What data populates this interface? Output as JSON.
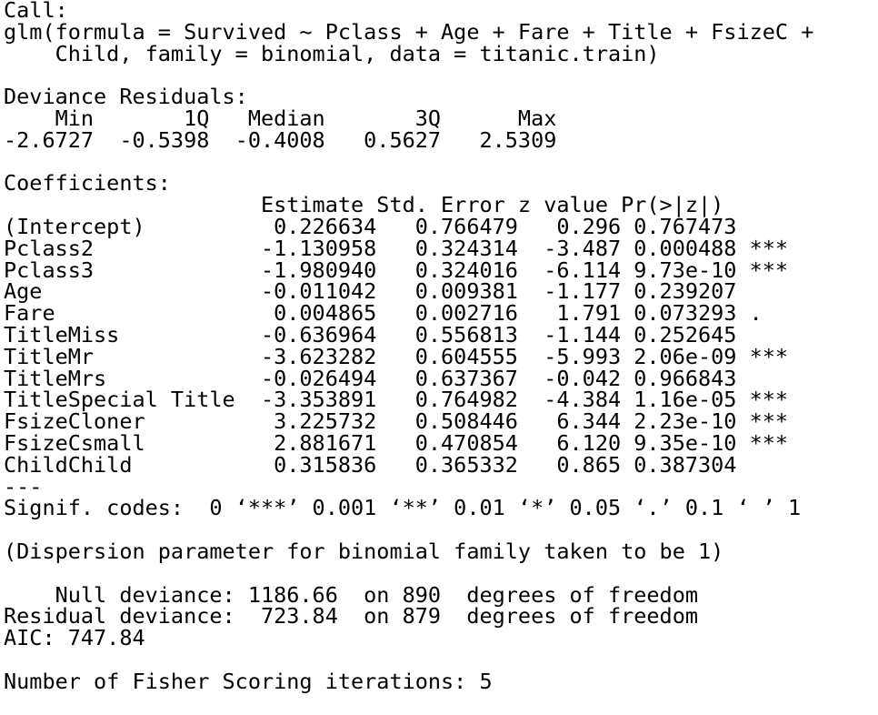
{
  "call": {
    "header": "Call:",
    "lines": [
      "glm(formula = Survived ~ Pclass + Age + Fare + Title + FsizeC +",
      "    Child, family = binomial, data = titanic.train)"
    ]
  },
  "deviance_residuals": {
    "header": "Deviance Residuals:",
    "labels_line": "    Min       1Q   Median       3Q      Max  ",
    "values_line": "-2.6727  -0.5398  -0.4008   0.5627   2.5309  ",
    "labels": [
      "Min",
      "1Q",
      "Median",
      "3Q",
      "Max"
    ],
    "values": [
      "-2.6727",
      "-0.5398",
      "-0.4008",
      "0.5627",
      "2.5309"
    ]
  },
  "coefficients": {
    "header": "Coefficients:",
    "columns": [
      "Estimate",
      "Std. Error",
      "z value",
      "Pr(>|z|)"
    ],
    "header_line": "                    Estimate Std. Error z value Pr(>|z|)    ",
    "rows": [
      {
        "name": "(Intercept)",
        "estimate": "0.226634",
        "std_error": "0.766479",
        "z_value": "0.296",
        "p_value": "0.767473",
        "signif": "",
        "line": "(Intercept)          0.226634   0.766479   0.296 0.767473    "
      },
      {
        "name": "Pclass2",
        "estimate": "-1.130958",
        "std_error": "0.324314",
        "z_value": "-3.487",
        "p_value": "0.000488",
        "signif": "***",
        "line": "Pclass2             -1.130958   0.324314  -3.487 0.000488 ***"
      },
      {
        "name": "Pclass3",
        "estimate": "-1.980940",
        "std_error": "0.324016",
        "z_value": "-6.114",
        "p_value": "9.73e-10",
        "signif": "***",
        "line": "Pclass3             -1.980940   0.324016  -6.114 9.73e-10 ***"
      },
      {
        "name": "Age",
        "estimate": "-0.011042",
        "std_error": "0.009381",
        "z_value": "-1.177",
        "p_value": "0.239207",
        "signif": "",
        "line": "Age                 -0.011042   0.009381  -1.177 0.239207    "
      },
      {
        "name": "Fare",
        "estimate": "0.004865",
        "std_error": "0.002716",
        "z_value": "1.791",
        "p_value": "0.073293",
        "signif": ".",
        "line": "Fare                 0.004865   0.002716   1.791 0.073293 .  "
      },
      {
        "name": "TitleMiss",
        "estimate": "-0.636964",
        "std_error": "0.556813",
        "z_value": "-1.144",
        "p_value": "0.252645",
        "signif": "",
        "line": "TitleMiss           -0.636964   0.556813  -1.144 0.252645    "
      },
      {
        "name": "TitleMr",
        "estimate": "-3.623282",
        "std_error": "0.604555",
        "z_value": "-5.993",
        "p_value": "2.06e-09",
        "signif": "***",
        "line": "TitleMr             -3.623282   0.604555  -5.993 2.06e-09 ***"
      },
      {
        "name": "TitleMrs",
        "estimate": "-0.026494",
        "std_error": "0.637367",
        "z_value": "-0.042",
        "p_value": "0.966843",
        "signif": "",
        "line": "TitleMrs            -0.026494   0.637367  -0.042 0.966843    "
      },
      {
        "name": "TitleSpecial Title",
        "estimate": "-3.353891",
        "std_error": "0.764982",
        "z_value": "-4.384",
        "p_value": "1.16e-05",
        "signif": "***",
        "line": "TitleSpecial Title  -3.353891   0.764982  -4.384 1.16e-05 ***"
      },
      {
        "name": "FsizeCloner",
        "estimate": "3.225732",
        "std_error": "0.508446",
        "z_value": "6.344",
        "p_value": "2.23e-10",
        "signif": "***",
        "line": "FsizeCloner          3.225732   0.508446   6.344 2.23e-10 ***"
      },
      {
        "name": "FsizeCsmall",
        "estimate": "2.881671",
        "std_error": "0.470854",
        "z_value": "6.120",
        "p_value": "9.35e-10",
        "signif": "***",
        "line": "FsizeCsmall          2.881671   0.470854   6.120 9.35e-10 ***"
      },
      {
        "name": "ChildChild",
        "estimate": "0.315836",
        "std_error": "0.365332",
        "z_value": "0.865",
        "p_value": "0.387304",
        "signif": "",
        "line": "ChildChild           0.315836   0.365332   0.865 0.387304    "
      }
    ]
  },
  "separator": "---",
  "signif_codes": "Signif. codes:  0 ‘***’ 0.001 ‘**’ 0.01 ‘*’ 0.05 ‘.’ 0.1 ‘ ’ 1",
  "dispersion": "(Dispersion parameter for binomial family taken to be 1)",
  "null_deviance": "    Null deviance: 1186.66  on 890  degrees of freedom",
  "residual_deviance": "Residual deviance:  723.84  on 879  degrees of freedom",
  "aic": "AIC: 747.84",
  "fisher_iterations": "Number of Fisher Scoring iterations: 5"
}
